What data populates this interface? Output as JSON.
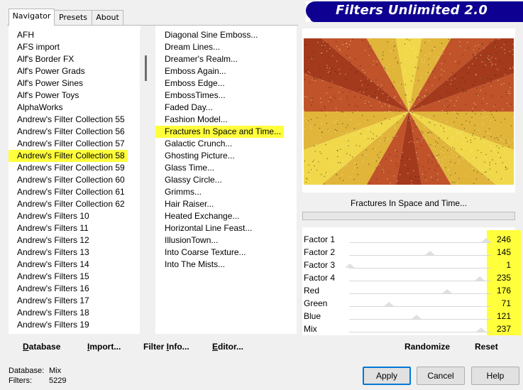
{
  "tabs": [
    "Navigator",
    "Presets",
    "About"
  ],
  "banner_title": "Filters Unlimited 2.0",
  "categories": {
    "items": [
      "AFH",
      "AFS import",
      "Alf's Border FX",
      "Alf's Power Grads",
      "Alf's Power Sines",
      "Alf's Power Toys",
      "AlphaWorks",
      "Andrew's Filter Collection 55",
      "Andrew's Filter Collection 56",
      "Andrew's Filter Collection 57",
      "Andrew's Filter Collection 58",
      "Andrew's Filter Collection 59",
      "Andrew's Filter Collection 60",
      "Andrew's Filter Collection 61",
      "Andrew's Filter Collection 62",
      "Andrew's Filters 10",
      "Andrew's Filters 11",
      "Andrew's Filters 12",
      "Andrew's Filters 13",
      "Andrew's Filters 14",
      "Andrew's Filters 15",
      "Andrew's Filters 16",
      "Andrew's Filters 17",
      "Andrew's Filters 18",
      "Andrew's Filters 19"
    ],
    "selected_index": 10
  },
  "filters": {
    "items": [
      "Diagonal Sine Emboss...",
      "Dream Lines...",
      "Dreamer's Realm...",
      "Emboss Again...",
      "Emboss Edge...",
      "EmbossTimes...",
      "Faded Day...",
      "Fashion Model...",
      "Fractures In Space and Time...",
      "Galactic Crunch...",
      "Ghosting Picture...",
      "Glass Time...",
      "Glassy Circle...",
      "Grimms...",
      "Hair Raiser...",
      "Heated Exchange...",
      "Horizontal Line Feast...",
      "IllusionTown...",
      "Into Coarse Texture...",
      "Into The Mists..."
    ],
    "selected_index": 8
  },
  "preview": {
    "filter_name": "Fractures In Space and Time...",
    "colors": {
      "gold": "#e0b53a",
      "yellow": "#f0d84a",
      "rust": "#c0532a",
      "deep": "#a43a1c"
    }
  },
  "sliders": [
    {
      "label": "Factor 1",
      "value": "246",
      "level": 0.965
    },
    {
      "label": "Factor 2",
      "value": "145",
      "level": 0.569
    },
    {
      "label": "Factor 3",
      "value": "1",
      "level": 0.004
    },
    {
      "label": "Factor 4",
      "value": "235",
      "level": 0.922
    },
    {
      "label": "Red",
      "value": "176",
      "level": 0.69
    },
    {
      "label": "Green",
      "value": "71",
      "level": 0.278
    },
    {
      "label": "Blue",
      "value": "121",
      "level": 0.475
    },
    {
      "label": "Mix",
      "value": "237",
      "level": 0.929
    }
  ],
  "bottom_buttons": {
    "database": {
      "first": "D",
      "rest": "atabase"
    },
    "import": {
      "first": "I",
      "rest": "mport..."
    },
    "filter_info": {
      "pre": "Filter ",
      "first": "I",
      "rest": "nfo..."
    },
    "editor": {
      "first": "E",
      "rest": "ditor..."
    },
    "randomize": "Randomize",
    "reset": "Reset"
  },
  "status": {
    "database_label": "Database:",
    "database_value": "Mix",
    "filters_label": "Filters:",
    "filters_value": "5229"
  },
  "dialog_buttons": {
    "apply": "Apply",
    "cancel": "Cancel",
    "help": "Help"
  }
}
